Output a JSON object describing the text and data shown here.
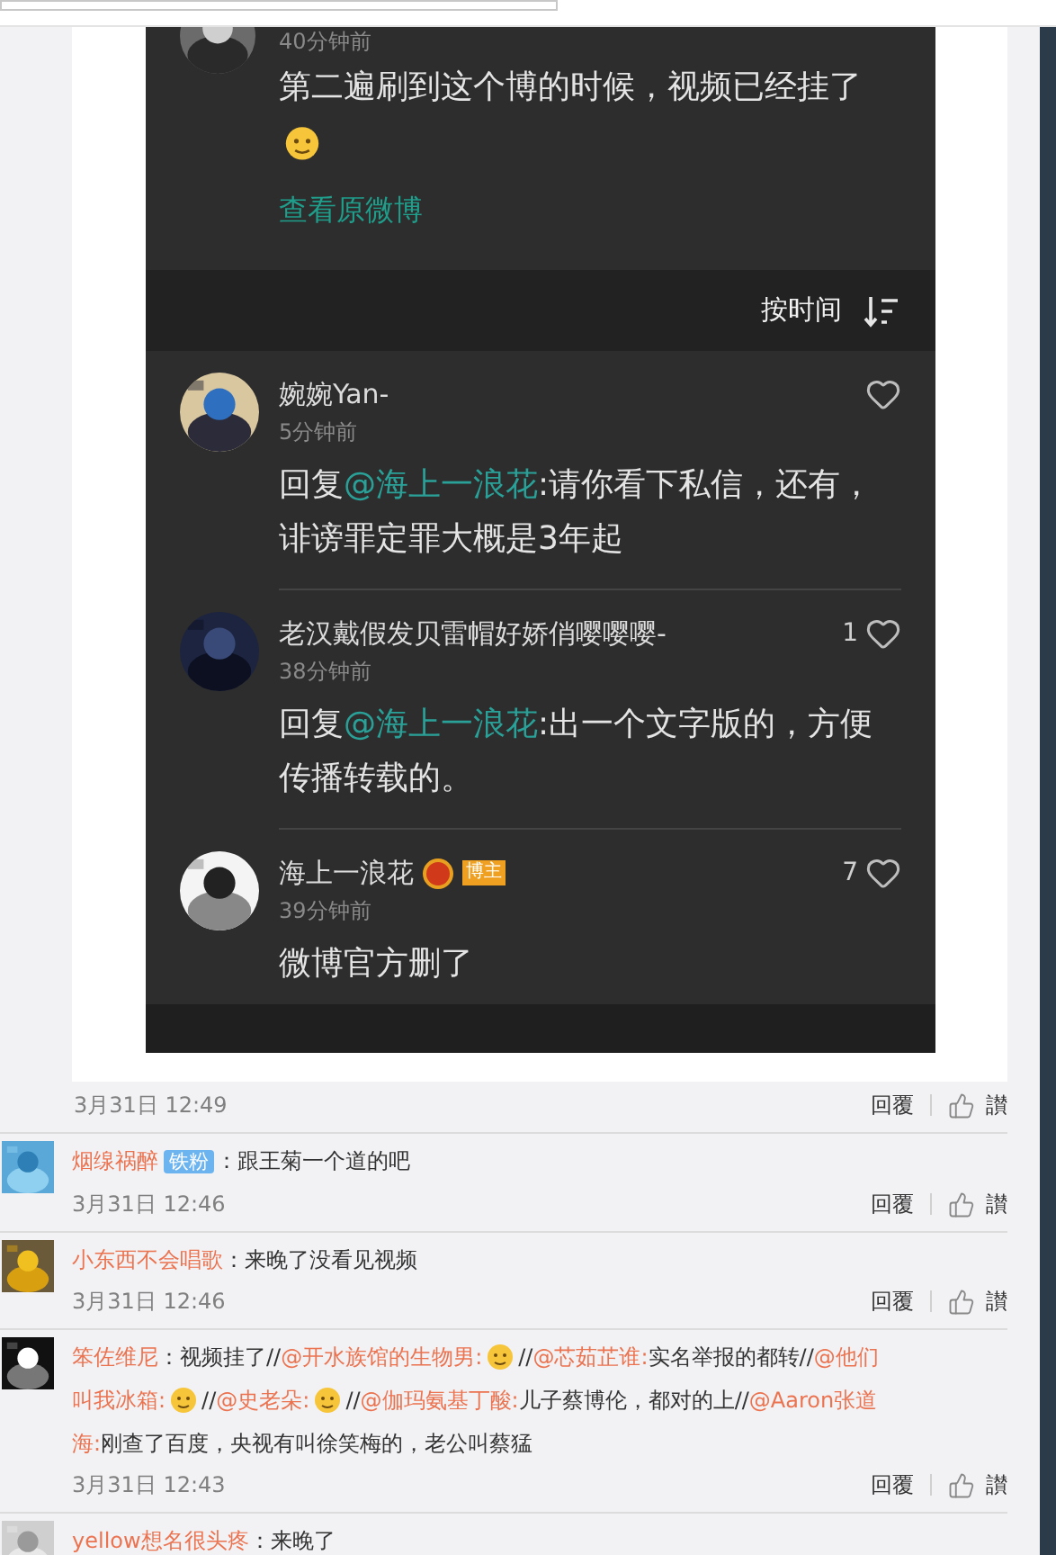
{
  "post_image": {
    "top_comment": {
      "time": "40分钟前",
      "content": [
        {
          "kind": "text",
          "text": "第二遍刷到这个博的时候，视频已经挂了"
        },
        {
          "kind": "emoji"
        }
      ],
      "link": "查看原微博"
    },
    "sort": {
      "label": "按时间"
    },
    "comments": [
      {
        "name": "婉婉Yan-",
        "time": "5分钟前",
        "content": [
          {
            "kind": "text",
            "text": "回复"
          },
          {
            "kind": "mention",
            "text": "@海上一浪花"
          },
          {
            "kind": "text",
            "text": ":请你看下私信，还有，诽谤罪定罪大概是3年起"
          }
        ]
      },
      {
        "name": "老汉戴假发贝雷帽好娇俏嘤嘤嘤-",
        "time": "38分钟前",
        "likes": "1",
        "content": [
          {
            "kind": "text",
            "text": "回复"
          },
          {
            "kind": "mention",
            "text": "@海上一浪花"
          },
          {
            "kind": "text",
            "text": ":出一个文字版的，方便传播转载的。"
          }
        ]
      },
      {
        "name": "海上一浪花",
        "verified": true,
        "badge": "博主",
        "time": "39分钟前",
        "likes": "7",
        "content": [
          {
            "kind": "text",
            "text": "微博官方删了"
          }
        ]
      }
    ]
  },
  "post_footer": {
    "date": "3月31日 12:49",
    "reply": "回覆",
    "like": "讃"
  },
  "comments": [
    {
      "name": "烟缐祸醉",
      "badge": "铁粉",
      "content": [
        {
          "kind": "text",
          "text": "：跟王菊一个道的吧"
        }
      ],
      "date": "3月31日 12:46",
      "reply": "回覆",
      "like": "讃"
    },
    {
      "name": "小东西不会唱歌",
      "content": [
        {
          "kind": "text",
          "text": "：来晚了没看见视频"
        }
      ],
      "date": "3月31日 12:46",
      "reply": "回覆",
      "like": "讃"
    },
    {
      "name": "笨佐维尼",
      "content": [
        {
          "kind": "text",
          "text": "：视频挂了//"
        },
        {
          "kind": "mention",
          "text": "@开水族馆的生物男:"
        },
        {
          "kind": "emoji"
        },
        {
          "kind": "text",
          "text": "//"
        },
        {
          "kind": "mention",
          "text": "@芯茹芷谁:"
        },
        {
          "kind": "text",
          "text": "实名举报的都转//"
        },
        {
          "kind": "mention",
          "text": "@他们叫我冰箱:"
        },
        {
          "kind": "emoji"
        },
        {
          "kind": "text",
          "text": "//"
        },
        {
          "kind": "mention",
          "text": "@史老朵:"
        },
        {
          "kind": "emoji"
        },
        {
          "kind": "text",
          "text": "//"
        },
        {
          "kind": "mention",
          "text": "@伽玛氨基丁酸:"
        },
        {
          "kind": "text",
          "text": "儿子蔡博伦，都对的上//"
        },
        {
          "kind": "mention",
          "text": "@Aaron张道海:"
        },
        {
          "kind": "text",
          "text": "刚查了百度，央视有叫徐笑梅的，老公叫蔡猛"
        }
      ],
      "date": "3月31日 12:43",
      "reply": "回覆",
      "like": "讃"
    },
    {
      "name": "yellow想名很头疼",
      "content": [
        {
          "kind": "text",
          "text": "：来晚了"
        }
      ]
    }
  ]
}
